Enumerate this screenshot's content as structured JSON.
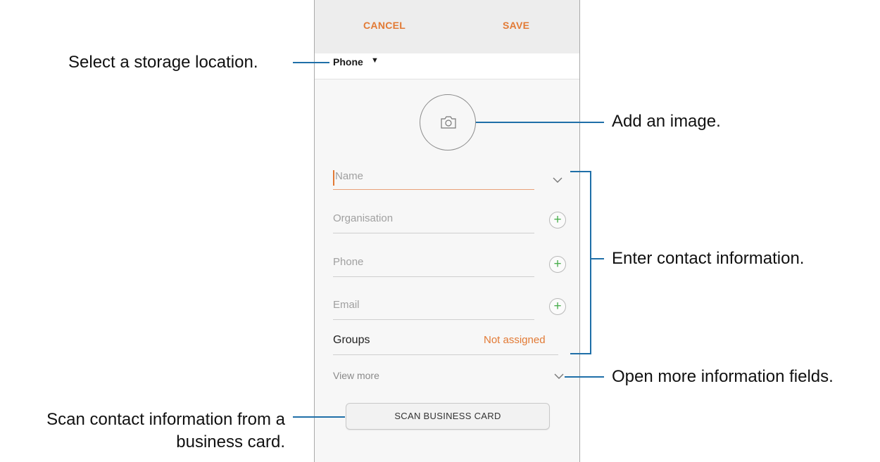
{
  "header": {
    "cancel_label": "CANCEL",
    "save_label": "SAVE"
  },
  "storage": {
    "label": "Phone",
    "caret": "▼"
  },
  "form": {
    "name_placeholder": "Name",
    "organisation_placeholder": "Organisation",
    "phone_placeholder": "Phone",
    "email_placeholder": "Email",
    "groups_label": "Groups",
    "groups_value": "Not assigned",
    "view_more_label": "View more",
    "scan_button_label": "SCAN BUSINESS CARD"
  },
  "callouts": {
    "storage": "Select a storage location.",
    "image": "Add an image.",
    "contact": "Enter contact information.",
    "more": "Open more information fields.",
    "scan_line1": "Scan contact information from a",
    "scan_line2": "business card."
  },
  "icons": {
    "avatar": "camera-icon",
    "add": "plus-circle-icon",
    "expand": "chevron-down-icon"
  },
  "colors": {
    "accent": "#e27a35",
    "plus": "#4caf50",
    "leader_line": "#1f6fa8"
  }
}
